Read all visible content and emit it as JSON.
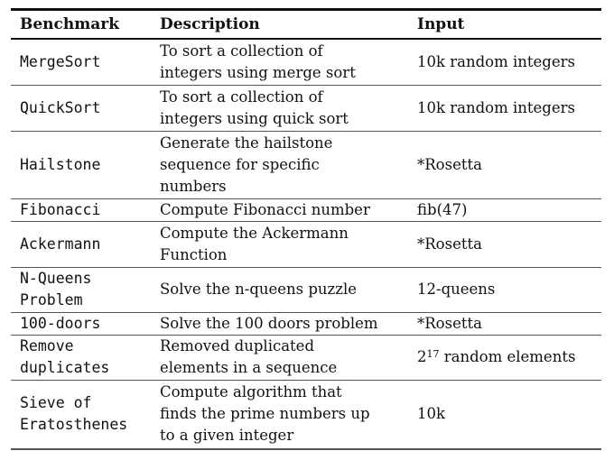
{
  "table": {
    "headers": [
      "Benchmark",
      "Description",
      "Input"
    ],
    "rows": [
      {
        "benchmark": [
          "MergeSort"
        ],
        "description": [
          "To sort a collection of",
          "integers using merge sort"
        ],
        "input": "10k random integers"
      },
      {
        "benchmark": [
          "QuickSort"
        ],
        "description": [
          "To sort a collection of",
          "integers using quick sort"
        ],
        "input": "10k random integers"
      },
      {
        "benchmark": [
          "Hailstone"
        ],
        "description": [
          "Generate the hailstone",
          "sequence for specific",
          "numbers"
        ],
        "input": "*Rosetta"
      },
      {
        "benchmark": [
          "Fibonacci"
        ],
        "description": [
          "Compute Fibonacci number"
        ],
        "input": "fib(47)"
      },
      {
        "benchmark": [
          "Ackermann"
        ],
        "description": [
          "Compute the Ackermann",
          "Function"
        ],
        "input": "*Rosetta"
      },
      {
        "benchmark": [
          "N-Queens",
          "Problem"
        ],
        "description": [
          "Solve the n-queens puzzle"
        ],
        "input": "12-queens"
      },
      {
        "benchmark": [
          "100-doors"
        ],
        "description": [
          "Solve the 100 doors problem"
        ],
        "input": "*Rosetta"
      },
      {
        "benchmark": [
          "Remove",
          "duplicates"
        ],
        "description": [
          "Removed duplicated",
          "elements in a sequence"
        ],
        "input_base": "2",
        "input_exp": "17",
        "input_rest": " random elements"
      },
      {
        "benchmark": [
          "Sieve of",
          "Eratosthenes"
        ],
        "description": [
          "Compute algorithm that",
          "finds the prime numbers up",
          "to a given integer"
        ],
        "input": "10k"
      }
    ]
  }
}
